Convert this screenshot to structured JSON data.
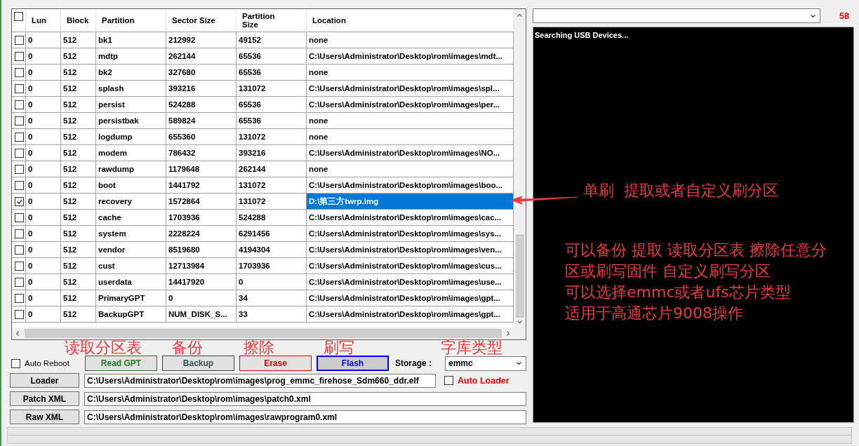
{
  "partition_table": {
    "header_checked": false,
    "columns": [
      "Lun",
      "Block",
      "Partition",
      "Sector Size",
      "Partition Size",
      "Location"
    ],
    "rows": [
      {
        "checked": false,
        "selected": false,
        "cells": [
          "0",
          "512",
          "bk1",
          "212992",
          "49152",
          "none"
        ]
      },
      {
        "checked": false,
        "selected": false,
        "cells": [
          "0",
          "512",
          "mdtp",
          "262144",
          "65536",
          "C:\\Users\\Administrator\\Desktop\\rom\\images\\mdt..."
        ]
      },
      {
        "checked": false,
        "selected": false,
        "cells": [
          "0",
          "512",
          "bk2",
          "327680",
          "65536",
          "none"
        ]
      },
      {
        "checked": false,
        "selected": false,
        "cells": [
          "0",
          "512",
          "splash",
          "393216",
          "131072",
          "C:\\Users\\Administrator\\Desktop\\rom\\images\\spl..."
        ]
      },
      {
        "checked": false,
        "selected": false,
        "cells": [
          "0",
          "512",
          "persist",
          "524288",
          "65536",
          "C:\\Users\\Administrator\\Desktop\\rom\\images\\per..."
        ]
      },
      {
        "checked": false,
        "selected": false,
        "cells": [
          "0",
          "512",
          "persistbak",
          "589824",
          "65536",
          "none"
        ]
      },
      {
        "checked": false,
        "selected": false,
        "cells": [
          "0",
          "512",
          "logdump",
          "655360",
          "131072",
          "none"
        ]
      },
      {
        "checked": false,
        "selected": false,
        "cells": [
          "0",
          "512",
          "modem",
          "786432",
          "393216",
          "C:\\Users\\Administrator\\Desktop\\rom\\images\\NO..."
        ]
      },
      {
        "checked": false,
        "selected": false,
        "cells": [
          "0",
          "512",
          "rawdump",
          "1179648",
          "262144",
          "none"
        ]
      },
      {
        "checked": false,
        "selected": false,
        "cells": [
          "0",
          "512",
          "boot",
          "1441792",
          "131072",
          "C:\\Users\\Administrator\\Desktop\\rom\\images\\boo..."
        ]
      },
      {
        "checked": true,
        "selected": true,
        "cells": [
          "0",
          "512",
          "recovery",
          "1572864",
          "131072",
          "D:\\第三方twrp.img"
        ]
      },
      {
        "checked": false,
        "selected": false,
        "cells": [
          "0",
          "512",
          "cache",
          "1703936",
          "524288",
          "C:\\Users\\Administrator\\Desktop\\rom\\images\\cac..."
        ]
      },
      {
        "checked": false,
        "selected": false,
        "cells": [
          "0",
          "512",
          "system",
          "2228224",
          "6291456",
          "C:\\Users\\Administrator\\Desktop\\rom\\images\\sys..."
        ]
      },
      {
        "checked": false,
        "selected": false,
        "cells": [
          "0",
          "512",
          "vendor",
          "8519680",
          "4194304",
          "C:\\Users\\Administrator\\Desktop\\rom\\images\\ven..."
        ]
      },
      {
        "checked": false,
        "selected": false,
        "cells": [
          "0",
          "512",
          "cust",
          "12713984",
          "1703936",
          "C:\\Users\\Administrator\\Desktop\\rom\\images\\cus..."
        ]
      },
      {
        "checked": false,
        "selected": false,
        "cells": [
          "0",
          "512",
          "userdata",
          "14417920",
          "0",
          "C:\\Users\\Administrator\\Desktop\\rom\\images\\use..."
        ]
      },
      {
        "checked": false,
        "selected": false,
        "cells": [
          "0",
          "512",
          "PrimaryGPT",
          "0",
          "34",
          "C:\\Users\\Administrator\\Desktop\\rom\\images\\gpt..."
        ]
      },
      {
        "checked": false,
        "selected": false,
        "cells": [
          "0",
          "512",
          "BackupGPT",
          "NUM_DISK_S...",
          "33",
          "C:\\Users\\Administrator\\Desktop\\rom\\images\\gpt..."
        ]
      }
    ]
  },
  "annotations": {
    "button_labels": [
      "读取分区表",
      "备份",
      "擦除",
      "刷写",
      "字库类型"
    ],
    "callout": "单刷  提取或者自定义刷分区",
    "notes": [
      "可以备份 提取 读取分区表 擦除任意分",
      "区或刷写固件 自定义刷写分区",
      "可以选择emmc或者ufs芯片类型",
      "适用于高通芯片9008操作"
    ]
  },
  "auto_reboot": {
    "label": "Auto Reboot",
    "checked": false
  },
  "actions": [
    {
      "label": "Read GPT",
      "color": "#1e7b1e",
      "focused": false
    },
    {
      "label": "Backup",
      "color": "#2f4f4f",
      "focused": false
    },
    {
      "label": "Erase",
      "color": "#dd0000",
      "focused": false
    },
    {
      "label": "Flash",
      "color": "#0000ff",
      "focused": true
    }
  ],
  "storage": {
    "label": "Storage :",
    "value": "emmc"
  },
  "files": [
    {
      "button": "Loader",
      "path": "C:\\Users\\Administrator\\Desktop\\rom\\images\\prog_emmc_firehose_Sdm660_ddr.elf",
      "option": {
        "label": "Auto Loader",
        "checked": false
      }
    },
    {
      "button": "Patch XML",
      "path": "C:\\Users\\Administrator\\Desktop\\rom\\images\\patch0.xml"
    },
    {
      "button": "Raw XML",
      "path": "C:\\Users\\Administrator\\Desktop\\rom\\images\\rawprogram0.xml"
    }
  ],
  "counter": "58",
  "log": {
    "lines": [
      "Searching USB Devices..."
    ]
  }
}
